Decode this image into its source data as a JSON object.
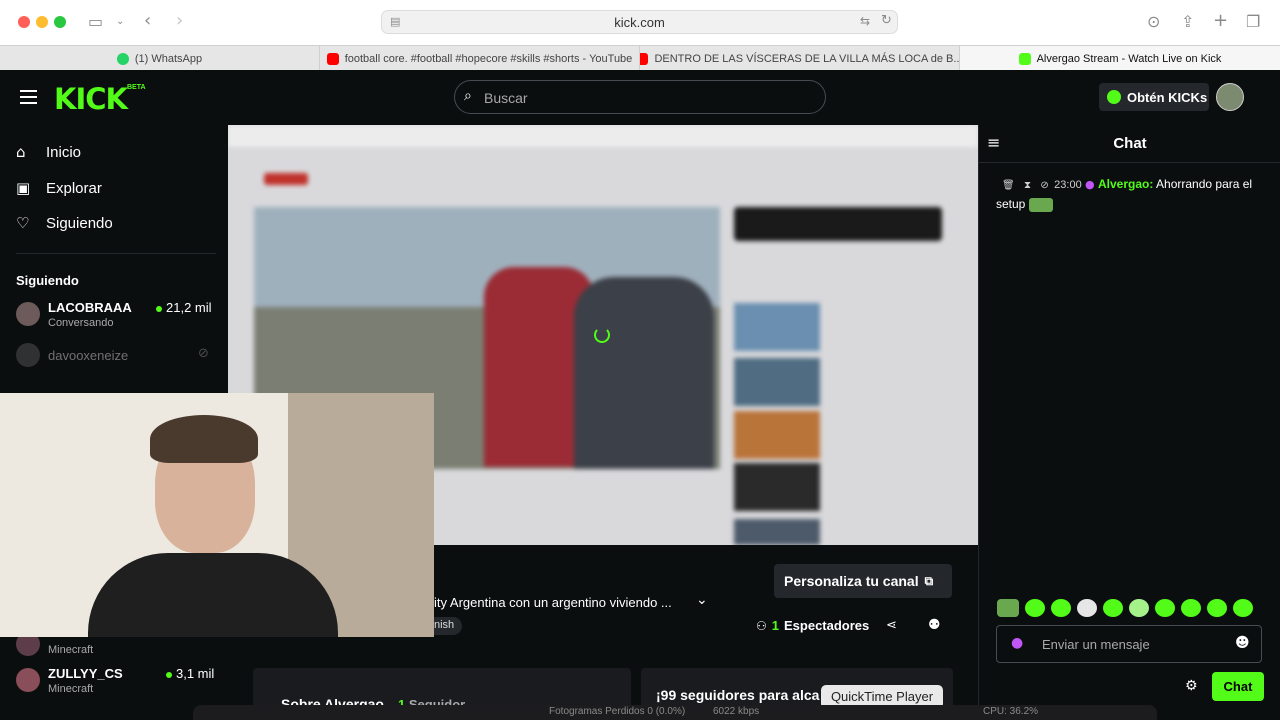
{
  "browser": {
    "url": "kick.com",
    "tabs": [
      {
        "label": "(1) WhatsApp",
        "favicon_color": "#25d366"
      },
      {
        "label": "football core. #football #hopecore #skills #shorts - YouTube",
        "favicon_color": "#ff0000"
      },
      {
        "label": "DENTRO DE LAS VÍSCERAS DE LA VILLA MÁS LOCA de B...",
        "favicon_color": "#ff0000"
      },
      {
        "label": "Alvergao Stream - Watch Live on Kick",
        "favicon_color": "#53fc18",
        "active": true
      }
    ]
  },
  "header": {
    "logo": "KICK",
    "logo_badge": "BETA",
    "search_placeholder": "Buscar",
    "kicks_button": "Obtén KICKs"
  },
  "sidebar": {
    "nav": [
      {
        "label": "Inicio",
        "icon": "home-icon"
      },
      {
        "label": "Explorar",
        "icon": "compass-icon"
      },
      {
        "label": "Siguiendo",
        "icon": "heart-icon"
      }
    ],
    "following_title": "Siguiendo",
    "channels": [
      {
        "name": "LACOBRAAA",
        "category": "Conversando",
        "viewers": "21,2 mil",
        "live": true
      },
      {
        "name": "davooxeneize",
        "category": "",
        "viewers": "",
        "live": false
      },
      {
        "name": "",
        "category": "Minecraft",
        "viewers": "",
        "live": true
      },
      {
        "name": "ZULLYY_CS",
        "category": "Minecraft",
        "viewers": "3,1 mil",
        "live": true
      },
      {
        "name": "",
        "category": "",
        "viewers": "",
        "live": true
      }
    ]
  },
  "stream": {
    "title_fragment": "ity Argentina con un argentino viviendo ...",
    "tag_fragment": "nish",
    "customize_button": "Personaliza tu canal",
    "viewer_count": "1",
    "viewer_label": "Espectadores",
    "about_title": "Sobre Alvergao",
    "followers_count": "1",
    "followers_label": "Seguidor",
    "goal_text": "¡99 seguidores para alca",
    "tooltip": "QuickTime Player"
  },
  "chat": {
    "title": "Chat",
    "messages": [
      {
        "time": "23:00",
        "user": "Alvergao",
        "text": "Ahorrando para el setup",
        "user_color": "#53fc18"
      }
    ],
    "input_placeholder": "Enviar un mensaje",
    "send_button": "Chat"
  },
  "dock_strip": {
    "dropped_frames": "Fotogramas Perdidos 0 (0.0%)",
    "bitrate": "6022 kbps",
    "cpu": "CPU: 36.2%"
  },
  "colors": {
    "brand": "#53fc18",
    "background": "#0b0e0f"
  }
}
